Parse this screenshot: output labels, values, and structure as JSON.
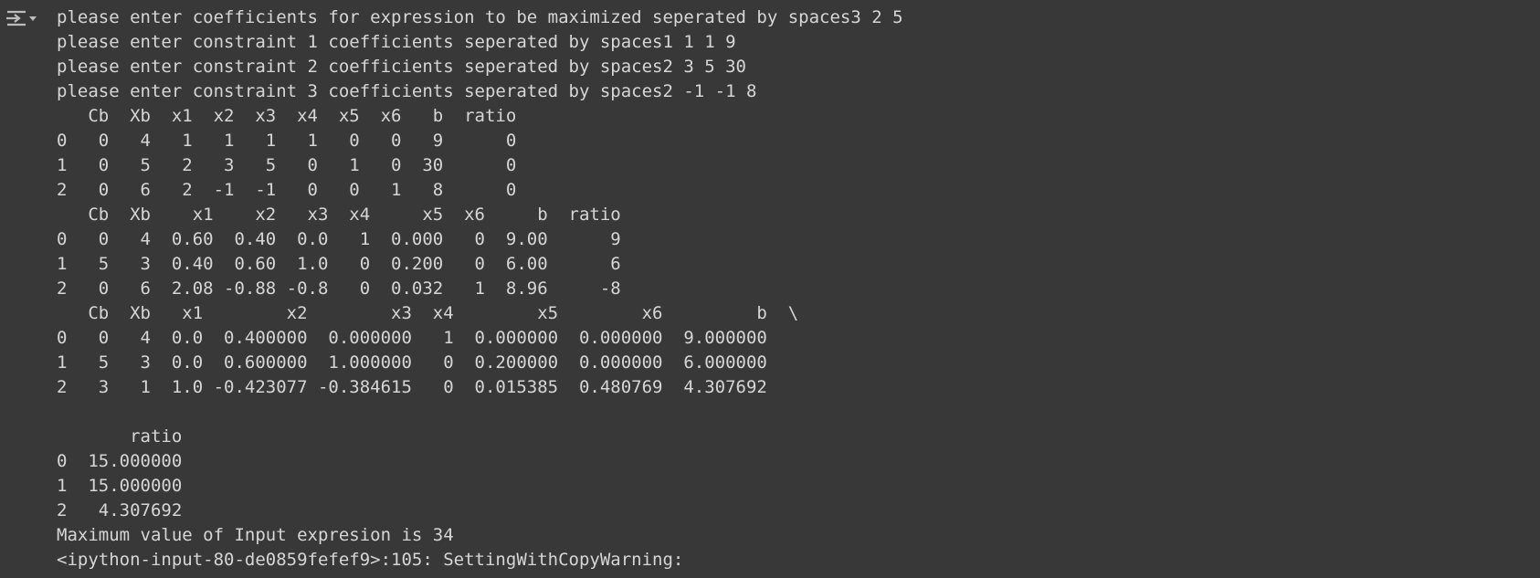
{
  "output": {
    "toggle_icon": "output-collapse-icon",
    "lines": [
      "please enter coefficients for expression to be maximized seperated by spaces3 2 5",
      "please enter constraint 1 coefficients seperated by spaces1 1 1 9",
      "please enter constraint 2 coefficients seperated by spaces2 3 5 30",
      "please enter constraint 3 coefficients seperated by spaces2 -1 -1 8",
      "   Cb  Xb  x1  x2  x3  x4  x5  x6   b  ratio",
      "0   0   4   1   1   1   1   0   0   9      0",
      "1   0   5   2   3   5   0   1   0  30      0",
      "2   0   6   2  -1  -1   0   0   1   8      0",
      "   Cb  Xb    x1    x2   x3  x4     x5  x6     b  ratio",
      "0   0   4  0.60  0.40  0.0   1  0.000   0  9.00      9",
      "1   5   3  0.40  0.60  1.0   0  0.200   0  6.00      6",
      "2   0   6  2.08 -0.88 -0.8   0  0.032   1  8.96     -8",
      "   Cb  Xb   x1        x2        x3  x4        x5        x6         b  \\",
      "0   0   4  0.0  0.400000  0.000000   1  0.000000  0.000000  9.000000",
      "1   5   3  0.0  0.600000  1.000000   0  0.200000  0.000000  6.000000",
      "2   3   1  1.0 -0.423077 -0.384615   0  0.015385  0.480769  4.307692",
      "",
      "       ratio",
      "0  15.000000",
      "1  15.000000",
      "2   4.307692",
      "Maximum value of Input expresion is 34",
      "<ipython-input-80-de0859fefef9>:105: SettingWithCopyWarning:"
    ]
  }
}
